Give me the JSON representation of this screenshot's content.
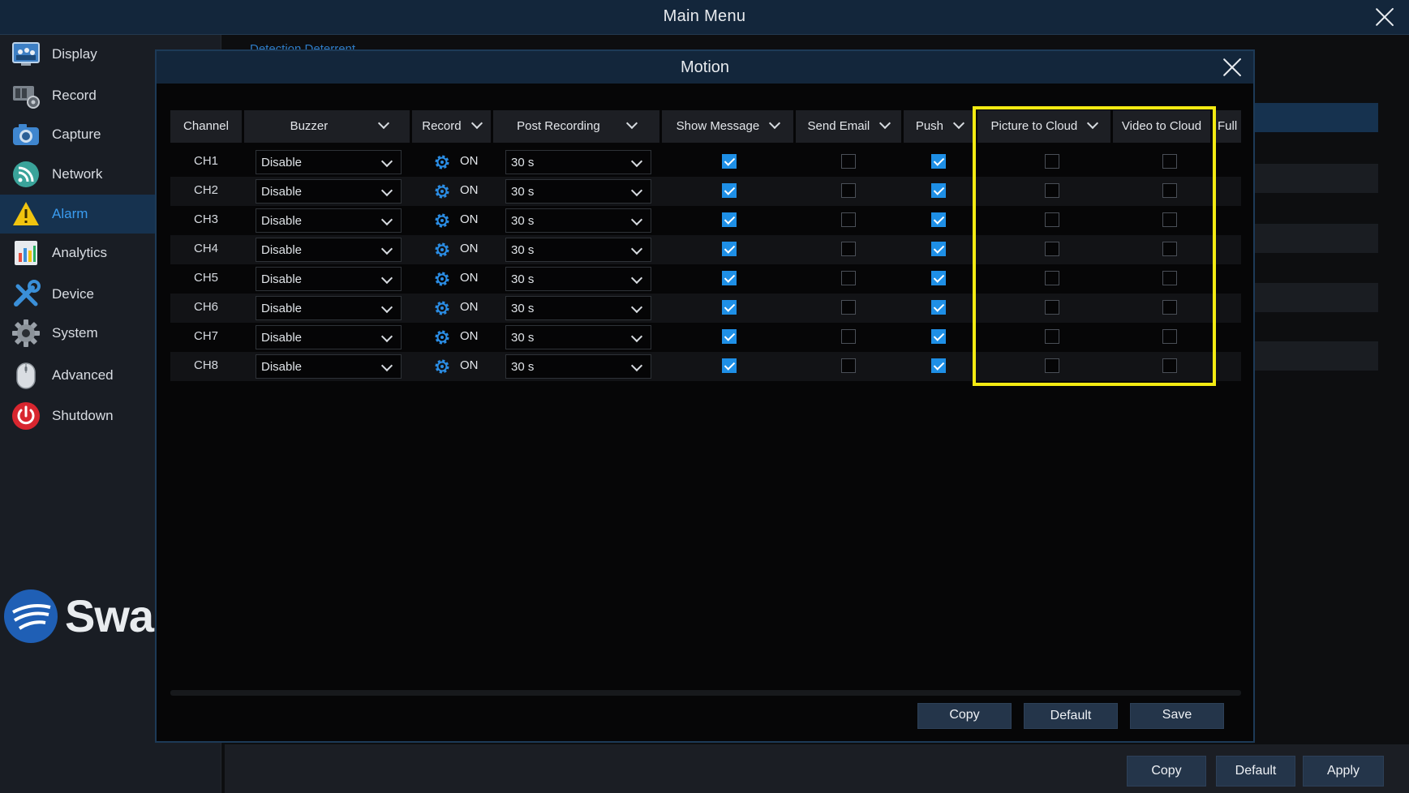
{
  "window": {
    "title": "Main Menu"
  },
  "sidebar": {
    "items": [
      {
        "label": "Display",
        "icon": "display-icon"
      },
      {
        "label": "Record",
        "icon": "record-icon"
      },
      {
        "label": "Capture",
        "icon": "camera-icon"
      },
      {
        "label": "Network",
        "icon": "network-icon"
      },
      {
        "label": "Alarm",
        "icon": "alarm-warning-icon",
        "active": true
      },
      {
        "label": "Analytics",
        "icon": "analytics-icon"
      },
      {
        "label": "Device",
        "icon": "device-tools-icon"
      },
      {
        "label": "System",
        "icon": "system-gear-icon"
      },
      {
        "label": "Advanced",
        "icon": "mouse-icon"
      },
      {
        "label": "Shutdown",
        "icon": "power-icon"
      }
    ],
    "brand_text": "Swa"
  },
  "background": {
    "breadcrumb": "Detection    Deterrent",
    "buttons": {
      "copy": "Copy",
      "default": "Default",
      "apply": "Apply"
    }
  },
  "modal": {
    "title": "Motion",
    "columns": {
      "channel": "Channel",
      "buzzer": "Buzzer",
      "record": "Record",
      "post_recording": "Post Recording",
      "show_message": "Show Message",
      "send_email": "Send Email",
      "push": "Push",
      "picture_to_cloud": "Picture to Cloud",
      "video_to_cloud": "Video to Cloud",
      "full": "Full"
    },
    "rows": [
      {
        "channel": "CH1",
        "buzzer": "Disable",
        "record": "ON",
        "post_recording": "30 s",
        "show_message": true,
        "send_email": false,
        "push": true,
        "picture_to_cloud": false,
        "video_to_cloud": false
      },
      {
        "channel": "CH2",
        "buzzer": "Disable",
        "record": "ON",
        "post_recording": "30 s",
        "show_message": true,
        "send_email": false,
        "push": true,
        "picture_to_cloud": false,
        "video_to_cloud": false
      },
      {
        "channel": "CH3",
        "buzzer": "Disable",
        "record": "ON",
        "post_recording": "30 s",
        "show_message": true,
        "send_email": false,
        "push": true,
        "picture_to_cloud": false,
        "video_to_cloud": false
      },
      {
        "channel": "CH4",
        "buzzer": "Disable",
        "record": "ON",
        "post_recording": "30 s",
        "show_message": true,
        "send_email": false,
        "push": true,
        "picture_to_cloud": false,
        "video_to_cloud": false
      },
      {
        "channel": "CH5",
        "buzzer": "Disable",
        "record": "ON",
        "post_recording": "30 s",
        "show_message": true,
        "send_email": false,
        "push": true,
        "picture_to_cloud": false,
        "video_to_cloud": false
      },
      {
        "channel": "CH6",
        "buzzer": "Disable",
        "record": "ON",
        "post_recording": "30 s",
        "show_message": true,
        "send_email": false,
        "push": true,
        "picture_to_cloud": false,
        "video_to_cloud": false
      },
      {
        "channel": "CH7",
        "buzzer": "Disable",
        "record": "ON",
        "post_recording": "30 s",
        "show_message": true,
        "send_email": false,
        "push": true,
        "picture_to_cloud": false,
        "video_to_cloud": false
      },
      {
        "channel": "CH8",
        "buzzer": "Disable",
        "record": "ON",
        "post_recording": "30 s",
        "show_message": true,
        "send_email": false,
        "push": true,
        "picture_to_cloud": false,
        "video_to_cloud": false
      }
    ],
    "buttons": {
      "copy": "Copy",
      "default": "Default",
      "save": "Save"
    }
  },
  "colors": {
    "accent": "#1e8fe6",
    "highlight": "#f3ea12",
    "title_bar": "#13263b"
  }
}
